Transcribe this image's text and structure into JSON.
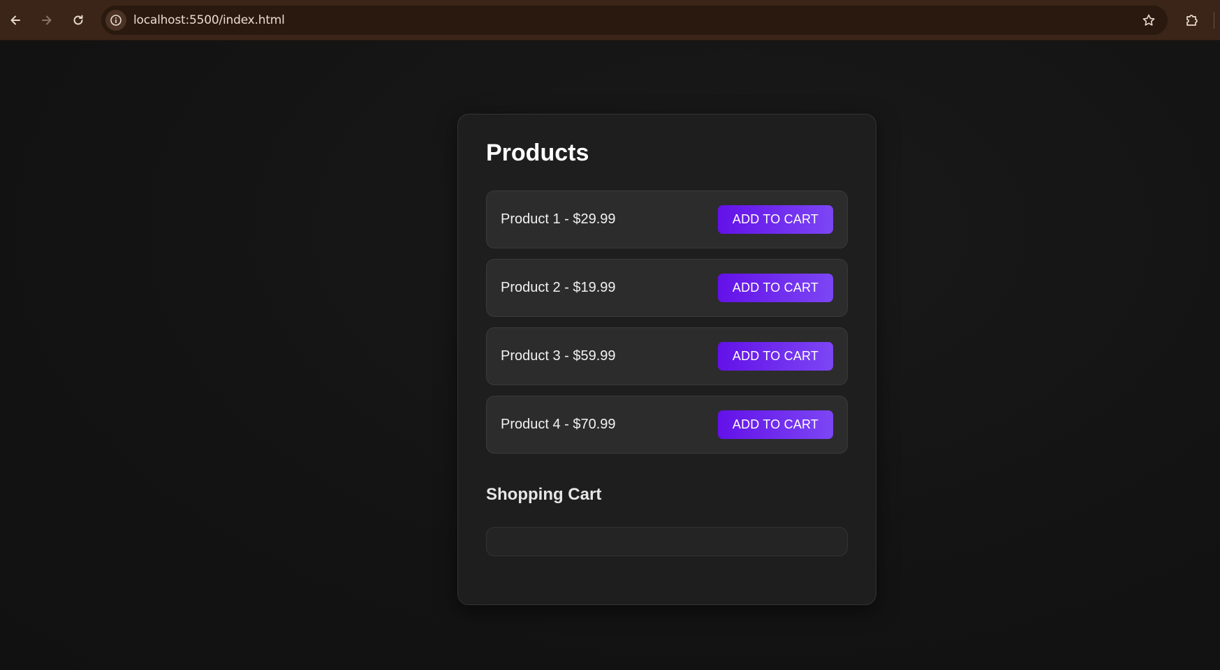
{
  "browser": {
    "url": "localhost:5500/index.html",
    "icons": {
      "back": "arrow-left-icon",
      "forward": "arrow-right-icon",
      "reload": "reload-icon",
      "site_info": "info-icon",
      "bookmark": "star-icon",
      "extensions": "puzzle-icon"
    }
  },
  "products_section": {
    "title": "Products",
    "items": [
      {
        "label": "Product 1 - $29.99",
        "button": "ADD TO CART"
      },
      {
        "label": "Product 2 - $19.99",
        "button": "ADD TO CART"
      },
      {
        "label": "Product 3 - $59.99",
        "button": "ADD TO CART"
      },
      {
        "label": "Product 4 - $70.99",
        "button": "ADD TO CART"
      }
    ]
  },
  "cart_section": {
    "title": "Shopping Cart"
  },
  "colors": {
    "page_background": "#121212",
    "card_background": "#1e1e1e",
    "item_background": "#2c2c2c",
    "button_gradient_start": "#6311e8",
    "button_gradient_end": "#7c46f4",
    "browser_chrome": "#3a2518"
  }
}
